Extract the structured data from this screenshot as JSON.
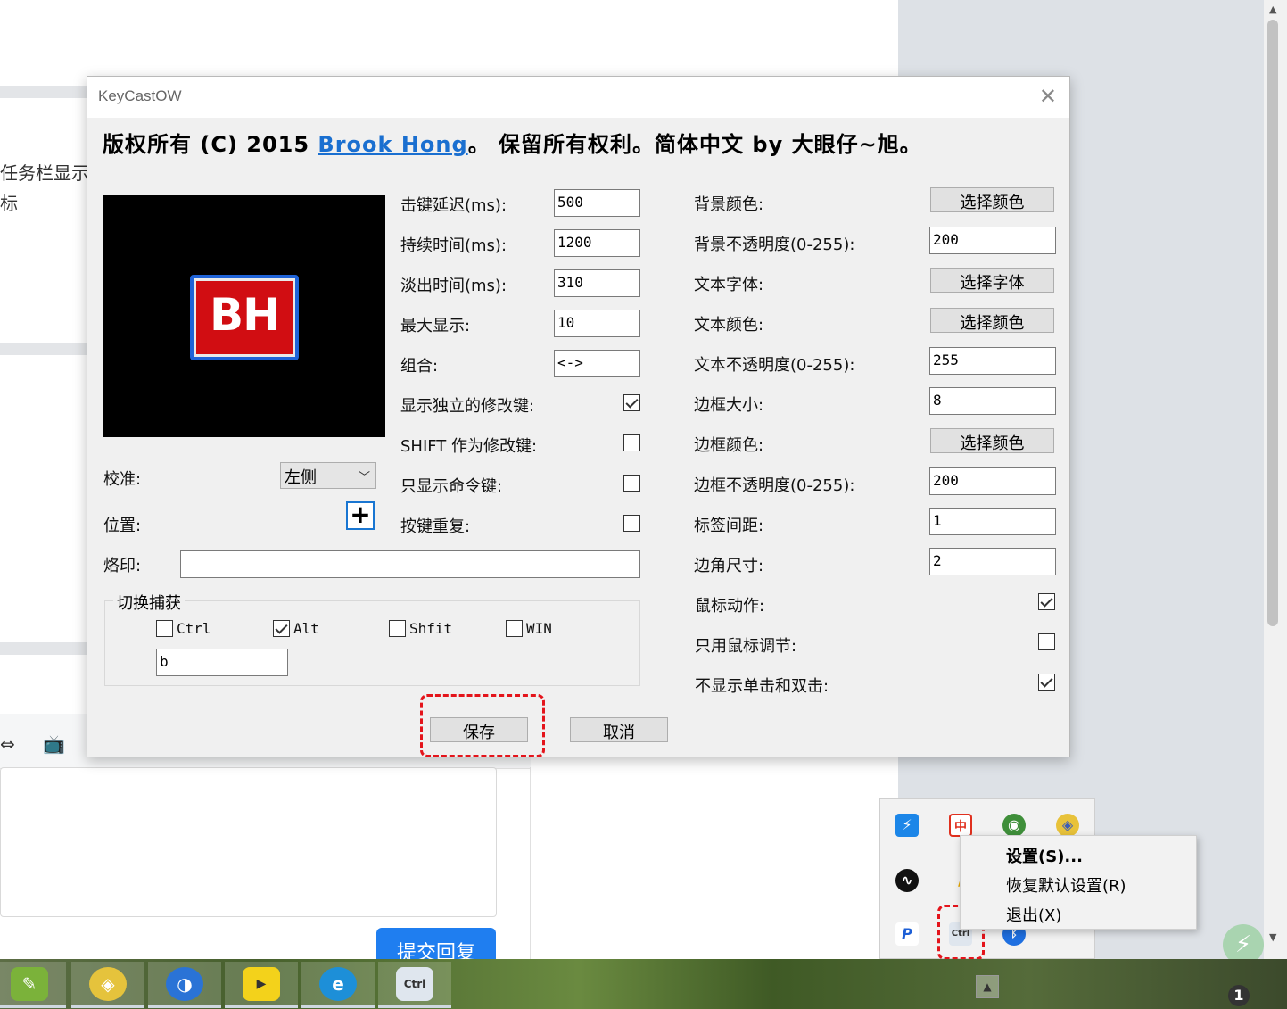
{
  "background": {
    "left_text_1": "任务栏显示",
    "left_text_2": "标",
    "submit_label": "提交回复"
  },
  "dialog": {
    "title": "KeyCastOW",
    "close_glyph": "✕",
    "copyright_prefix": "版权所有 (C) 2015 ",
    "copyright_link": "Brook Hong",
    "copyright_suffix": "。 保留所有权利。简体中文 by 大眼仔~旭。",
    "logo_text": "BH",
    "align_label": "校准:",
    "align_value": "左侧",
    "position_label": "位置:",
    "stamp_label": "烙印:",
    "stamp_value": "",
    "middle": [
      {
        "label": "击键延迟(ms):",
        "value": "500"
      },
      {
        "label": "持续时间(ms):",
        "value": "1200"
      },
      {
        "label": "淡出时间(ms):",
        "value": "310"
      },
      {
        "label": "最大显示:",
        "value": "10"
      },
      {
        "label": "组合:",
        "value": "<->"
      }
    ],
    "middle_checks": [
      {
        "label": "显示独立的修改键:",
        "checked": true
      },
      {
        "label": "SHIFT 作为修改键:",
        "checked": false
      },
      {
        "label": "只显示命令键:",
        "checked": false
      },
      {
        "label": "按键重复:",
        "checked": false
      }
    ],
    "right": {
      "bg_color_label": "背景颜色:",
      "bg_color_button": "选择颜色",
      "bg_opacity_label": "背景不透明度(0-255):",
      "bg_opacity_value": "200",
      "text_font_label": "文本字体:",
      "text_font_button": "选择字体",
      "text_color_label": "文本颜色:",
      "text_color_button": "选择颜色",
      "text_opacity_label": "文本不透明度(0-255):",
      "text_opacity_value": "255",
      "border_size_label": "边框大小:",
      "border_size_value": "8",
      "border_color_label": "边框颜色:",
      "border_color_button": "选择颜色",
      "border_opacity_label": "边框不透明度(0-255):",
      "border_opacity_value": "200",
      "label_spacing_label": "标签间距:",
      "label_spacing_value": "1",
      "corner_size_label": "边角尺寸:",
      "corner_size_value": "2"
    },
    "right_checks": [
      {
        "label": "鼠标动作:",
        "checked": true
      },
      {
        "label": "只用鼠标调节:",
        "checked": false
      },
      {
        "label": "不显示单击和双击:",
        "checked": true
      }
    ],
    "toggle": {
      "title": "切换捕获",
      "ctrl": "Ctrl",
      "ctrl_checked": false,
      "alt": "Alt",
      "alt_checked": true,
      "shift": "Shfit",
      "shift_checked": false,
      "win": "WIN",
      "win_checked": false,
      "key_value": "b"
    },
    "save_label": "保存",
    "cancel_label": "取消"
  },
  "tray_menu": {
    "settings": "设置(S)...",
    "restore": "恢复默认设置(R)",
    "exit": "退出(X)"
  },
  "taskbar": {
    "badge": "1"
  },
  "colors": {
    "accent_link": "#1a6fd0",
    "highlight_dash": "#e4141b",
    "logo_red": "#d10d12",
    "logo_blue": "#1f63d8"
  }
}
